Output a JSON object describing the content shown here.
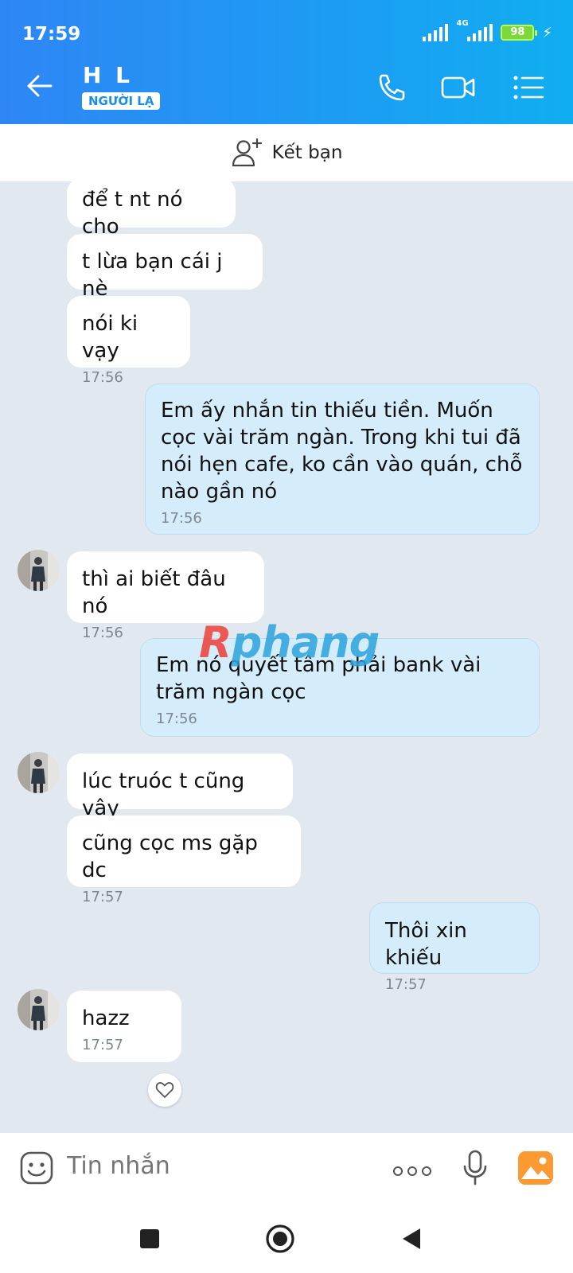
{
  "status_bar": {
    "time": "17:59",
    "network": "4G",
    "battery": "98"
  },
  "header": {
    "contact_name": "H L",
    "contact_tag": "NGƯỜI LẠ"
  },
  "add_friend": {
    "label": "Kết bạn"
  },
  "messages": [
    {
      "side": "in",
      "text": "để t nt nó cho",
      "time": ""
    },
    {
      "side": "in",
      "text": "t lừa bạn cái j nè",
      "time": ""
    },
    {
      "side": "in",
      "text": "nói ki vạy",
      "time": "17:56"
    },
    {
      "side": "out",
      "text": "Em ấy nhắn tin thiếu tiền. Muốn cọc vài trăm ngàn. Trong khi tui đã nói hẹn cafe, ko cần vào quán, chỗ nào gần nó",
      "time": "17:56"
    },
    {
      "side": "in",
      "text": "thì ai biết đâu nó",
      "time": "17:56"
    },
    {
      "side": "out",
      "text": "Em nó quyết tâm phải bank vài trăm ngàn cọc",
      "time": "17:56"
    },
    {
      "side": "in",
      "text": "lúc truóc t cũng vậy",
      "time": ""
    },
    {
      "side": "in",
      "text": "cũng cọc ms gặp dc",
      "time": "17:57"
    },
    {
      "side": "out",
      "text": "Thôi xin khiếu",
      "time": "17:57"
    },
    {
      "side": "in",
      "text": "hazz",
      "time": "17:57"
    }
  ],
  "watermark": {
    "first_letter": "R",
    "rest": "phang"
  },
  "input": {
    "placeholder": "Tin nhắn"
  },
  "colors": {
    "header_start": "#2e86f5",
    "header_end": "#10aef0",
    "incoming_bubble": "#ffffff",
    "outgoing_bubble": "#d5ecfb",
    "chat_bg": "#e2e8ef"
  }
}
